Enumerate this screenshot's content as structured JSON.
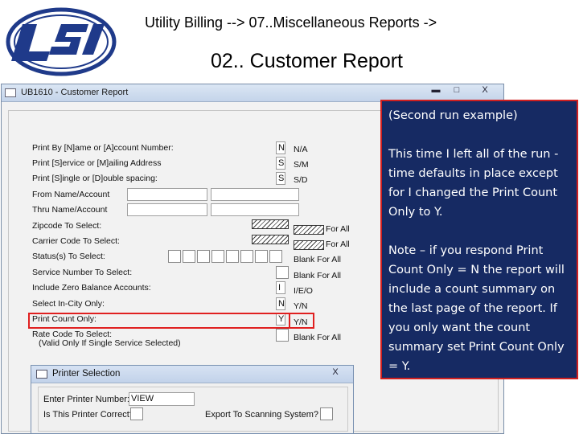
{
  "header": {
    "line1": "Utility Billing -->   07..Miscellaneous Reports ->",
    "line2": "02.. Customer Report"
  },
  "logo": {
    "icon": "lsi-logo",
    "color": "#1f3a8a"
  },
  "window": {
    "title": "UB1610 - Customer Report",
    "min_glyph": "▬",
    "max_glyph": "□",
    "close_glyph": "X"
  },
  "form": {
    "print_by": {
      "label": "Print By [N]ame or [A]ccount Number:",
      "value": "N",
      "hint": "N/A"
    },
    "print_service": {
      "label": "Print [S]ervice or [M]ailing Address",
      "value": "S",
      "hint": "S/M"
    },
    "print_spacing": {
      "label": "Print [S]ingle or [D]ouble spacing:",
      "value": "S",
      "hint": "S/D"
    },
    "from_name": {
      "label": "From Name/Account"
    },
    "thru_name": {
      "label": "Thru Name/Account"
    },
    "zipcode": {
      "label": "Zipcode To Select:",
      "hint": "For All"
    },
    "carrier": {
      "label": "Carrier Code To Select:",
      "hint": "For All"
    },
    "status": {
      "label": "Status(s) To Select:",
      "hint": "Blank For All"
    },
    "service": {
      "label": "Service Number To Select:",
      "hint": "Blank For All"
    },
    "zero_balance": {
      "label": "Include Zero Balance Accounts:",
      "value": "I",
      "hint": "I/E/O"
    },
    "in_city": {
      "label": "Select In-City Only:",
      "value": "N",
      "hint": "Y/N"
    },
    "print_count": {
      "label": "Print Count Only:",
      "value": "Y",
      "hint": "Y/N"
    },
    "rate_code": {
      "label": "Rate Code To Select:",
      "note": "(Valid Only If Single Service Selected)",
      "hint": "Blank For All"
    }
  },
  "callout": {
    "p1": "(Second run example)",
    "p2": "This time I left all of the run -time defaults in place except for I changed the Print Count Only to Y.",
    "p3": "Note – if you respond Print Count Only = N  the report will include a count summary on the last page of the report.   If you only want the count summary set Print Count Only = Y.",
    "bg_color": "#162a63",
    "border_color": "#d02020"
  },
  "printer_dialog": {
    "title": "Printer Selection",
    "close_glyph": "X",
    "printer_label": "Enter Printer Number:",
    "printer_value": "VIEW",
    "correct_label": "Is This Printer Correct?",
    "export_label": "Export To Scanning System?"
  },
  "highlight_color": "#e02020"
}
